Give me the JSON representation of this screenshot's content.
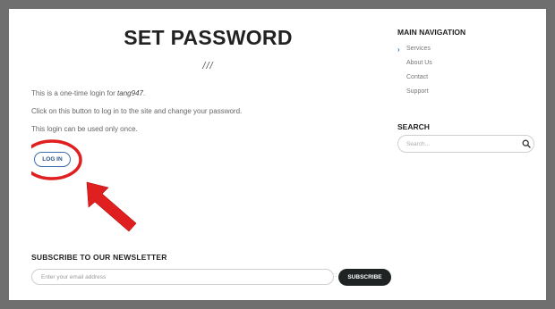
{
  "page": {
    "title": "SET PASSWORD",
    "separator": "///"
  },
  "messages": {
    "line1_prefix": "This is a one-time login for ",
    "username": "tang947",
    "line1_suffix": ".",
    "line2": "Click on this button to log in to the site and change your password.",
    "line3": "This login can be used only once."
  },
  "login_button": {
    "label": "LOG IN"
  },
  "annotation": {
    "color": "#e02020"
  },
  "sidebar": {
    "nav_heading": "MAIN NAVIGATION",
    "nav_items": [
      {
        "label": "Services",
        "active": true
      },
      {
        "label": "About Us",
        "active": false
      },
      {
        "label": "Contact",
        "active": false
      },
      {
        "label": "Support",
        "active": false
      }
    ],
    "search_heading": "SEARCH",
    "search_placeholder": "Search..."
  },
  "newsletter": {
    "heading": "SUBSCRIBE TO OUR NEWSLETTER",
    "email_placeholder": "Enter your email address",
    "separator": ":",
    "button_label": "SUBSCRIBE"
  },
  "colors": {
    "frame": "#6f6f6f",
    "accent": "#3a6fb0",
    "button_dark": "#202323"
  }
}
